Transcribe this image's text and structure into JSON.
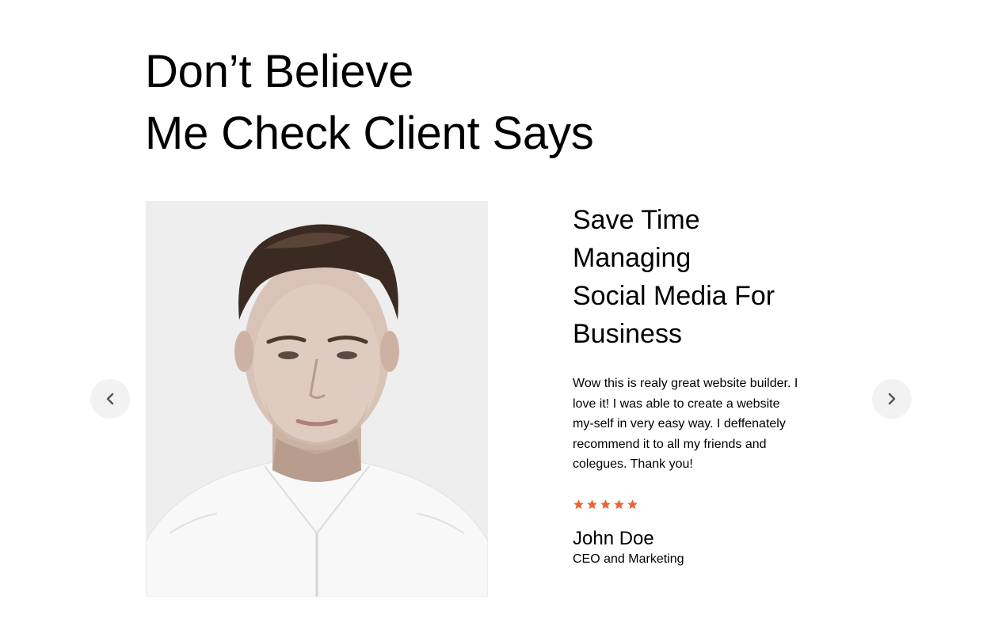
{
  "heading": {
    "line1": "Don’t Believe",
    "line2": "Me Check Client Says"
  },
  "testimonial": {
    "title_lines": [
      "Save Time",
      "Managing",
      "Social Media For",
      "Business"
    ],
    "quote": "Wow this is realy great website builder. I love it! I was able to create a website my-self in very easy way. I deffenately recommend it to all my friends and colegues. Thank you!",
    "rating": 5,
    "name": "John Doe",
    "role": "CEO and Marketing"
  },
  "navigation": {
    "prev_icon": "chevron-left-icon",
    "next_icon": "chevron-right-icon"
  },
  "colors": {
    "star": "#e8653a",
    "nav_bg": "#f2f2f2",
    "photo_bg": "#eeeeee"
  }
}
